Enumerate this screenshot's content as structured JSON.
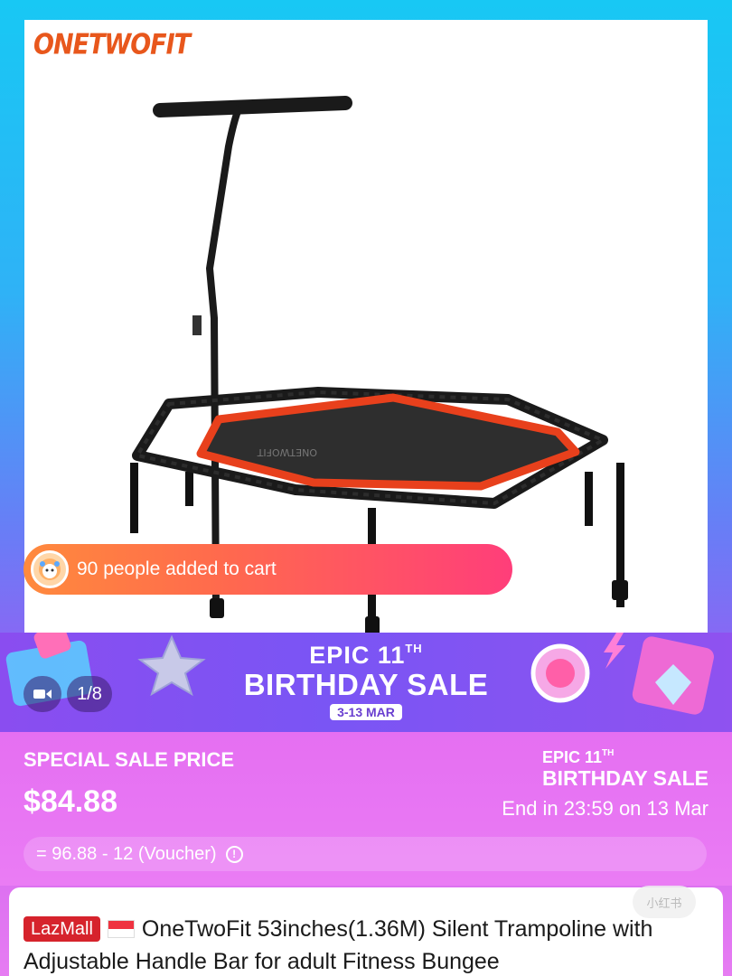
{
  "product_image": {
    "brand_logo": "ONETWOFIT",
    "frame_color": "#1a1a1a",
    "mat_border_color": "#e8401c"
  },
  "cart_notice": {
    "text": "90 people added to cart",
    "avatar_icon": "mascot-avatar-icon"
  },
  "banner": {
    "epic": "EPIC 11",
    "epic_sup": "TH",
    "title": "BIRTHDAY SALE",
    "dates": "3-13 MAR"
  },
  "media": {
    "video_icon": "video-camera-icon",
    "counter": "1/8"
  },
  "sale": {
    "label": "SPECIAL SALE PRICE",
    "price": "$84.88",
    "event_line1": "EPIC 11",
    "event_line1_sup": "TH",
    "event_line2": "BIRTHDAY SALE",
    "countdown": "End in 23:59 on 13 Mar",
    "voucher": "= 96.88 - 12 (Voucher)"
  },
  "title": {
    "badge": "LazMall",
    "flag_icon": "singapore-flag-icon",
    "text": "OneTwoFit 53inches(1.36M) Silent Trampoline with Adjustable Handle Bar for adult Fitness Bungee"
  },
  "colors": {
    "accent_orange": "#e8571c",
    "lazmall_red": "#d6232c",
    "banner_purple": "#8a4df0",
    "sale_pink": "#e56ff2"
  }
}
